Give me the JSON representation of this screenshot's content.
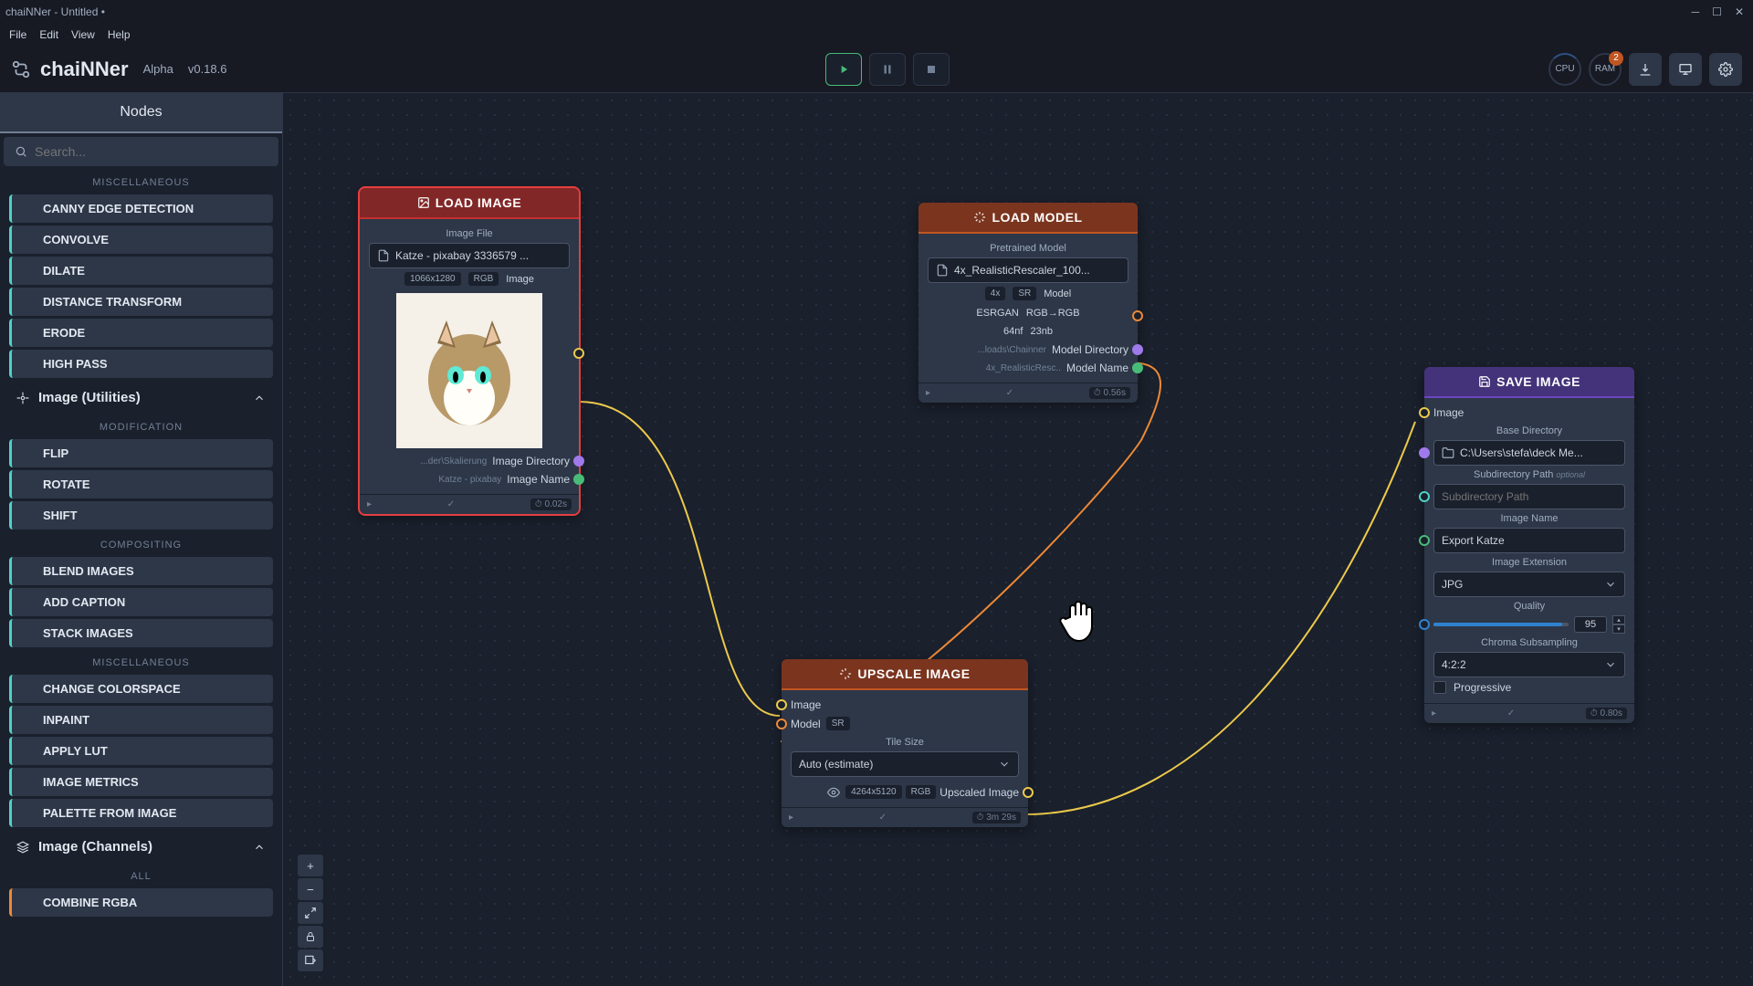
{
  "titlebar": {
    "title": "chaiNNer - Untitled •"
  },
  "menubar": {
    "file": "File",
    "edit": "Edit",
    "view": "View",
    "help": "Help"
  },
  "toolbar": {
    "brand": "chaiNNer",
    "tag_alpha": "Alpha",
    "version": "v0.18.6",
    "cpu": "CPU",
    "ram": "RAM",
    "ram_badge": "2"
  },
  "sidebar": {
    "tab": "Nodes",
    "search_placeholder": "Search...",
    "sections": {
      "miscellaneous": "MISCELLANEOUS",
      "modification": "MODIFICATION",
      "compositing": "COMPOSITING",
      "all": "ALL"
    },
    "categories": {
      "image_utilities": "Image (Utilities)",
      "image_channels": "Image (Channels)"
    },
    "items": {
      "canny": "CANNY EDGE DETECTION",
      "convolve": "CONVOLVE",
      "dilate": "DILATE",
      "distance": "DISTANCE TRANSFORM",
      "erode": "ERODE",
      "highpass": "HIGH PASS",
      "flip": "FLIP",
      "rotate": "ROTATE",
      "shift": "SHIFT",
      "blend": "BLEND IMAGES",
      "caption": "ADD CAPTION",
      "stack": "STACK IMAGES",
      "colorspace": "CHANGE COLORSPACE",
      "inpaint": "INPAINT",
      "applylut": "APPLY LUT",
      "metrics": "IMAGE METRICS",
      "palette": "PALETTE FROM IMAGE",
      "combine": "COMBINE RGBA"
    }
  },
  "nodes": {
    "load_image": {
      "title": "LOAD IMAGE",
      "field_label": "Image File",
      "file_value": "Katze - pixabay 3336579 ...",
      "dims": "1066x1280",
      "mode": "RGB",
      "tag": "Image",
      "dir_value": "...der\\Skalierung",
      "dir_label": "Image Directory",
      "name_value": "Katze - pixabay",
      "name_label": "Image Name",
      "timing": "0.02s"
    },
    "load_model": {
      "title": "LOAD MODEL",
      "field_label": "Pretrained Model",
      "file_value": "4x_RealisticRescaler_100...",
      "scale": "4x",
      "sr": "SR",
      "tag": "Model",
      "arch": "ESRGAN",
      "colormode": "RGB→RGB",
      "nf": "64nf",
      "nb": "23nb",
      "dir_value": "...loads\\Chainner",
      "dir_label": "Model Directory",
      "name_value": "4x_RealisticResc..",
      "name_label": "Model Name",
      "timing": "0.56s"
    },
    "upscale": {
      "title": "UPSCALE IMAGE",
      "in_image": "Image",
      "in_model": "Model",
      "sr": "SR",
      "tilesize_label": "Tile Size",
      "tilesize_value": "Auto (estimate)",
      "out_dims": "4264x5120",
      "out_mode": "RGB",
      "out_label": "Upscaled Image",
      "timing": "3m 29s"
    },
    "save": {
      "title": "SAVE IMAGE",
      "in_image": "Image",
      "dir_label": "Base Directory",
      "dir_value": "C:\\Users\\stefa\\deck Me...",
      "subdir_label": "Subdirectory Path",
      "subdir_placeholder": "Subdirectory Path",
      "optional": "optional",
      "name_label": "Image Name",
      "name_value": "Export Katze",
      "ext_label": "Image Extension",
      "ext_value": "JPG",
      "quality_label": "Quality",
      "quality_value": "95",
      "chroma_label": "Chroma Subsampling",
      "chroma_value": "4:2:2",
      "progressive_label": "Progressive",
      "timing": "0.80s"
    }
  }
}
